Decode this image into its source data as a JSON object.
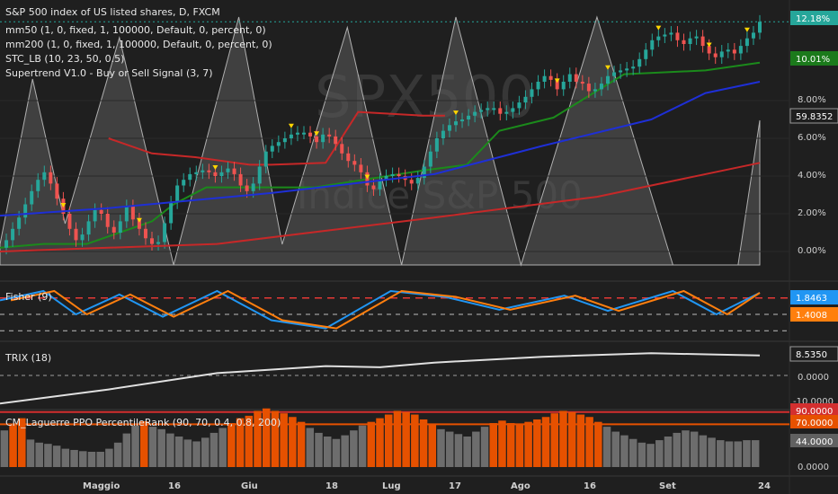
{
  "legend_main": [
    "S&P 500 index of US listed shares, D, FXCM",
    "mm50 (1, 0, fixed, 1, 100000, Default, 0, percent, 0)",
    "mm200 (1, 0, fixed, 1, 100000, Default, 0, percent, 0)",
    "STC_LB (10, 23, 50, 0.5)",
    "Supertrend V1.0 - Buy or Sell Signal (3, 7)"
  ],
  "watermark": {
    "symbol": "SPX500",
    "name": "Indice S&P 500"
  },
  "axis_main": {
    "ticks": [
      "8.00%",
      "6.00%",
      "4.00%",
      "2.00%",
      "0.00%"
    ],
    "badges": [
      {
        "text": "12.18%",
        "bg": "#26a69a"
      },
      {
        "text": "10.01%",
        "bg": "#1b7a1b"
      },
      {
        "text": "59.8352",
        "bg": "#1f1f1f"
      }
    ]
  },
  "x_axis": {
    "labels": [
      "Maggio",
      "16",
      "Giu",
      "18",
      "Lug",
      "17",
      "Ago",
      "16",
      "Set",
      "24"
    ]
  },
  "fisher": {
    "title": "Fisher (9)",
    "badges": [
      {
        "text": "1.8463",
        "bg": "#2196f3"
      },
      {
        "text": "1.4008",
        "bg": "#ff7f0e"
      }
    ]
  },
  "trix": {
    "title": "TRIX (18)",
    "ticks": [
      "0.0000",
      "-10.0000"
    ],
    "badges": [
      {
        "text": "8.5350",
        "bg": "#1f1f1f"
      }
    ]
  },
  "laguerre": {
    "title": "CM_Laguerre PPO PercentileRank (90, 70, 0.4, 0.8, 200)",
    "ticks": [
      "0.0000"
    ],
    "badges": [
      {
        "text": "90.0000",
        "bg": "#d32f2f"
      },
      {
        "text": "70.0000",
        "bg": "#e65100"
      },
      {
        "text": "44.0000",
        "bg": "#616161"
      }
    ]
  },
  "colors": {
    "up": "#26a69a",
    "down": "#ef5350",
    "mm50": "#1e2fd6",
    "mm200": "#c62828",
    "stc": "#b0b0b0",
    "supertrend_up": "#1b8a1b",
    "supertrend_down": "#c62828",
    "fisher1": "#2196f3",
    "fisher2": "#ff7f0e",
    "trix": "#e0e0e0",
    "bar_gray": "#6d6d6d",
    "bar_orange": "#e65100",
    "signal": "#ffd600"
  },
  "chart_data": {
    "type": "candlestick",
    "y_unit": "percent",
    "ylim": [
      -0.6,
      12.6
    ],
    "price_path": [
      0.2,
      0.6,
      1.2,
      1.8,
      2.5,
      3.2,
      3.8,
      4.2,
      3.6,
      2.8,
      2.0,
      1.2,
      0.6,
      0.9,
      1.6,
      2.2,
      2.0,
      1.3,
      1.0,
      1.6,
      2.4,
      1.7,
      1.2,
      0.7,
      0.4,
      0.5,
      1.5,
      2.6,
      3.5,
      3.8,
      4.1,
      4.2,
      4.3,
      4.2,
      4.0,
      4.2,
      4.4,
      4.1,
      3.5,
      3.2,
      3.6,
      4.5,
      5.3,
      5.6,
      5.8,
      6.0,
      6.2,
      6.3,
      6.3,
      6.1,
      5.8,
      6.2,
      6.1,
      5.7,
      5.2,
      4.8,
      4.6,
      4.2,
      3.5,
      3.3,
      3.8,
      4.0,
      4.1,
      4.0,
      3.8,
      3.6,
      3.9,
      4.5,
      5.3,
      6.0,
      6.4,
      6.7,
      6.9,
      7.0,
      7.2,
      7.4,
      7.5,
      7.6,
      7.6,
      7.3,
      7.4,
      7.6,
      7.9,
      8.2,
      8.6,
      9.0,
      9.3,
      9.1,
      8.6,
      9.0,
      9.4,
      9.0,
      8.9,
      8.5,
      8.6,
      8.9,
      9.3,
      9.5,
      9.6,
      9.7,
      9.8,
      10.2,
      10.7,
      11.2,
      11.4,
      11.5,
      11.6,
      11.2,
      11.0,
      11.3,
      11.4,
      10.9,
      10.5,
      10.3,
      10.6,
      10.7,
      10.5,
      10.9,
      11.3,
      11.6,
      12.18
    ],
    "mm50_path": [
      [
        0,
        1.9
      ],
      [
        20,
        2.3
      ],
      [
        50,
        3.1
      ],
      [
        80,
        4.1
      ],
      [
        100,
        5.6
      ],
      [
        120,
        7.0
      ],
      [
        130,
        8.4
      ],
      [
        140,
        9.0
      ]
    ],
    "mm200_path": [
      [
        0,
        0.0
      ],
      [
        40,
        0.4
      ],
      [
        80,
        1.8
      ],
      [
        110,
        2.9
      ],
      [
        140,
        4.7
      ]
    ],
    "supertrend_up": [
      [
        0,
        0.2
      ],
      [
        8,
        0.4
      ],
      [
        10,
        0.4
      ],
      [
        16,
        0.4
      ],
      [
        22,
        1.0
      ],
      [
        28,
        1.6
      ],
      [
        32,
        2.5
      ],
      [
        38,
        3.4
      ],
      [
        47,
        3.4
      ],
      [
        58,
        3.4
      ],
      [
        78,
        4.3
      ],
      [
        86,
        4.6
      ],
      [
        92,
        6.4
      ],
      [
        102,
        7.1
      ],
      [
        115,
        9.4
      ],
      [
        130,
        9.6
      ],
      [
        140,
        10.01
      ]
    ],
    "supertrend_down": [
      [
        20,
        6.0
      ],
      [
        24,
        5.6
      ],
      [
        28,
        5.2
      ],
      [
        36,
        5.0
      ],
      [
        46,
        4.6
      ],
      [
        50,
        4.6
      ],
      [
        60,
        4.7
      ],
      [
        66,
        7.4
      ],
      [
        78,
        7.2
      ],
      [
        82,
        7.2
      ]
    ],
    "stc_cycles": [
      [
        0,
        1.0
      ],
      [
        6,
        9.0
      ],
      [
        12,
        2.0
      ],
      [
        22,
        11.0
      ],
      [
        32,
        0.0
      ],
      [
        44,
        12.0
      ],
      [
        52,
        1.0
      ],
      [
        64,
        11.5
      ],
      [
        74,
        0.0
      ],
      [
        84,
        12.0
      ],
      [
        96,
        0.0
      ],
      [
        110,
        12.0
      ],
      [
        124,
        0.0
      ],
      [
        136,
        0.0
      ],
      [
        140,
        7.0
      ]
    ],
    "fisher_series": [
      [
        0,
        1.2
      ],
      [
        8,
        2.0
      ],
      [
        14,
        0.0
      ],
      [
        22,
        1.7
      ],
      [
        30,
        -0.2
      ],
      [
        40,
        2.0
      ],
      [
        50,
        -0.5
      ],
      [
        60,
        -1.2
      ],
      [
        72,
        2.0
      ],
      [
        82,
        1.5
      ],
      [
        92,
        0.4
      ],
      [
        104,
        1.6
      ],
      [
        112,
        0.3
      ],
      [
        124,
        2.0
      ],
      [
        132,
        0.0
      ],
      [
        140,
        1.8463
      ]
    ],
    "trix_series": [
      [
        0,
        -12
      ],
      [
        20,
        -6
      ],
      [
        40,
        1
      ],
      [
        60,
        4
      ],
      [
        70,
        3.5
      ],
      [
        80,
        5.5
      ],
      [
        100,
        8
      ],
      [
        120,
        9.5
      ],
      [
        135,
        8.8
      ],
      [
        140,
        8.535
      ]
    ],
    "laguerre_values": [
      60,
      70,
      80,
      45,
      40,
      38,
      35,
      30,
      28,
      26,
      25,
      25,
      30,
      40,
      55,
      68,
      75,
      66,
      62,
      55,
      50,
      45,
      42,
      48,
      56,
      64,
      72,
      80,
      84,
      92,
      96,
      92,
      88,
      82,
      74,
      64,
      56,
      50,
      46,
      52,
      60,
      68,
      74,
      80,
      86,
      92,
      90,
      86,
      78,
      70,
      62,
      58,
      54,
      50,
      58,
      66,
      72,
      76,
      72,
      70,
      74,
      78,
      82,
      88,
      92,
      90,
      86,
      82,
      74,
      66,
      58,
      52,
      46,
      40,
      38,
      44,
      50,
      56,
      60,
      58,
      52,
      48,
      44,
      42,
      42,
      44,
      44
    ],
    "laguerre_lines": {
      "upper": 90,
      "lower": 70
    }
  }
}
